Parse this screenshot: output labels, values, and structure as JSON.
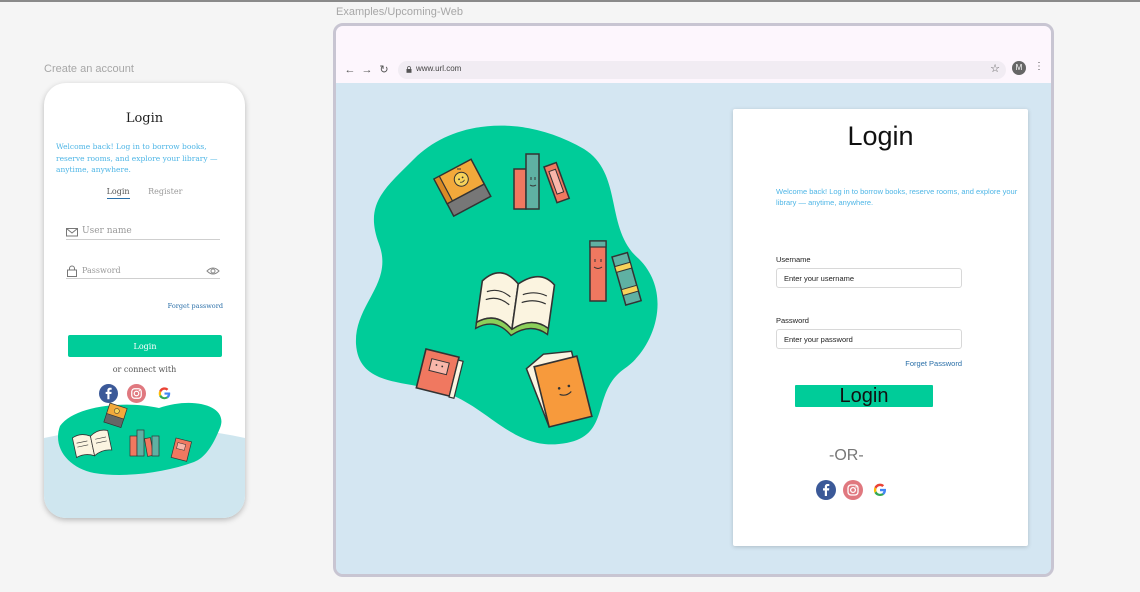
{
  "mobile_frame_label": "Create an account",
  "web_frame_label": "Examples/Upcoming-Web",
  "mobile": {
    "title": "Login",
    "welcome": "Welcome back! Log in to borrow books, reserve rooms, and explore your library — anytime, anywhere.",
    "tabs": [
      {
        "label": "Login",
        "active": true
      },
      {
        "label": "Register",
        "active": false
      }
    ],
    "username_placeholder": "User name",
    "password_placeholder": "Password",
    "forget_password": "Forget password",
    "login_button": "Login",
    "or_connect": "or connect with",
    "social": [
      "facebook-icon",
      "instagram-icon",
      "google-icon"
    ]
  },
  "browser": {
    "url": "www.url.com",
    "avatar_initial": "M"
  },
  "web": {
    "title": "Login",
    "welcome": "Welcome back! Log in to borrow books, reserve rooms, and explore your library — anytime, anywhere.",
    "username_label": "Username",
    "username_placeholder": "Enter your username",
    "password_label": "Password",
    "password_placeholder": "Enter your password",
    "forget_password": "Forget Password",
    "login_button": "Login",
    "or_text": "-OR-",
    "social": [
      "facebook-icon",
      "instagram-icon",
      "google-icon"
    ]
  },
  "colors": {
    "accent": "#00cc99",
    "link": "#2a6fa8",
    "welcome_text": "#4fb6e6",
    "web_background": "#d4e6f2"
  }
}
